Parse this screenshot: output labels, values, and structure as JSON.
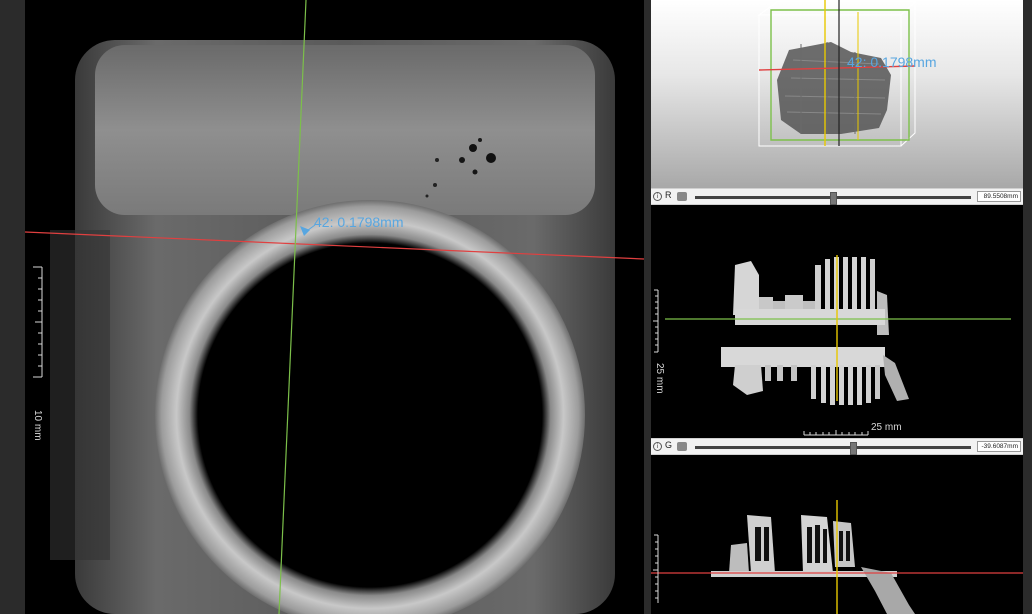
{
  "main_view": {
    "measurement_text": "42: 0.1798mm",
    "scale_label": "10 mm"
  },
  "view_3d": {
    "measurement_text": "42: 0.1798mm"
  },
  "slider_r": {
    "axis": "R",
    "value": "89.5508mm",
    "position": 0.49
  },
  "view_coronal": {
    "vertical_scale_label": "25 mm",
    "horizontal_scale_label": "25 mm"
  },
  "slider_g": {
    "axis": "G",
    "value": "-39.6087mm",
    "position": 0.56
  },
  "view_sagittal": {},
  "colors": {
    "red_axis": "#e04040",
    "green_axis": "#7cc04a",
    "yellow_axis": "#e8c800",
    "measurement": "#58a6e0"
  }
}
